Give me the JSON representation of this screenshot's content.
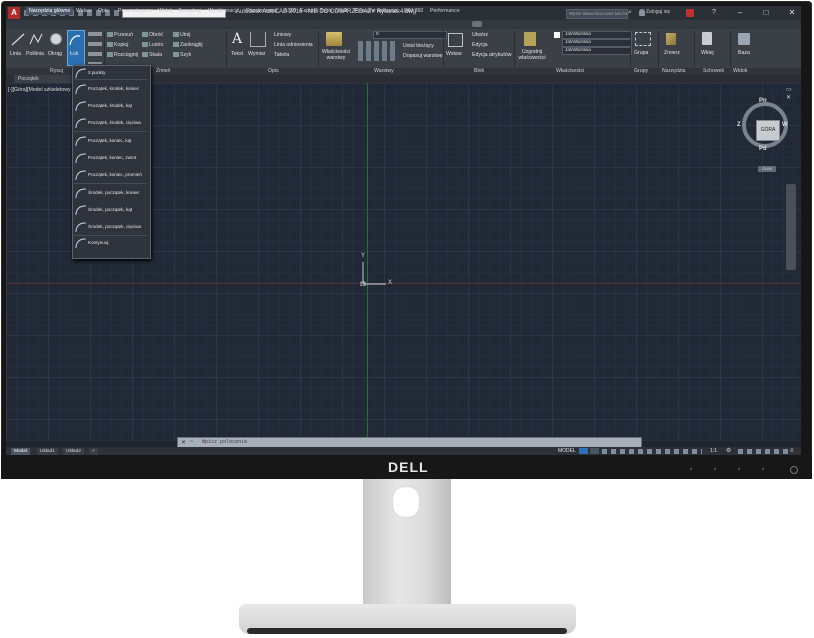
{
  "device": {
    "brand": "DELL"
  },
  "app": {
    "title": "Autodesk AutoCAD 2016 - NIE DO ODSPRZEDAŻY   Rysunek4.dwg",
    "search_placeholder": "Wpisz słowo kluczowe lub frazę",
    "signin_label": "Zaloguj się"
  },
  "ribbon_tabs": [
    "Narzędzia główne",
    "Wstaw",
    "Opis",
    "Parametryczne",
    "Widok",
    "Zarządzaj",
    "Wyniki pracy",
    "Rozszerzenia",
    "A360",
    "Express Tools",
    "Vault",
    "Polecane aplikacje",
    "BIM 360",
    "Performance"
  ],
  "ribbon": {
    "draw": {
      "line": "Linia",
      "polyline": "Polilinia",
      "circle": "Okrąg",
      "arc": "Łuk"
    },
    "modify": {
      "move": "Przesuń",
      "rotate": "Obróć",
      "trim": "Utnij",
      "copy": "Kopiuj",
      "mirror": "Lustro",
      "fillet": "Zaokrąglij",
      "stretch": "Rozciągnij",
      "scale": "Skala",
      "array": "Szyk"
    },
    "annotation": {
      "text": "Tekst",
      "dimension": "Wymiar",
      "linear": "Liniowy",
      "leader": "Linia odniesienia",
      "table": "Tabela"
    },
    "layers": {
      "layer_properties": "Właściwości warstwy",
      "current_layer": "0",
      "make_current": "Ustal bieżący",
      "match_layer": "Dopasuj warstwę"
    },
    "block": {
      "insert": "Wstaw",
      "create": "Utwórz",
      "edit": "Edycja",
      "edit_attributes": "Edycja atrybutów"
    },
    "properties": {
      "match": "Uzgodnij właściwości",
      "color": "JakWarstwa",
      "linetype": "JakWarstwa",
      "lineweight": "JakWarstwa"
    },
    "groups": {
      "group": "Grupa"
    },
    "utilities": {
      "measure": "Zmierz"
    },
    "clipboard": {
      "paste": "Wklej"
    },
    "view": {
      "base": "Baza"
    }
  },
  "panel_labels": [
    "Rysuj",
    "Zmień",
    "Opis",
    "Warstwy",
    "Blok",
    "Właściwości",
    "Grupy",
    "Narzędzia",
    "Schowek",
    "Widok"
  ],
  "document_tab": "Początek",
  "viewport_controls": "[-][Góra][Model szkieletowy 2D]",
  "arc_menu": {
    "items": [
      "3 punkty",
      "Początek, środek, koniec",
      "Początek, środek, kąt",
      "Początek, środek, cięciwa",
      "Początek, koniec, kąt",
      "Początek, koniec, zwrot",
      "Początek, koniec, promień",
      "Środek, początek, koniec",
      "Środek, początek, kąt",
      "Środek, początek, cięciwa",
      "Kontynuuj"
    ]
  },
  "viewcube": {
    "face": "GÓRA",
    "north": "Pn",
    "south": "Pd",
    "east": "W",
    "west": "Z",
    "wcs": "GUW"
  },
  "ucs": {
    "x_label": "X",
    "y_label": "Y"
  },
  "command_line": {
    "placeholder": "Wpisz polecenie"
  },
  "layout_tabs": [
    "Model",
    "Układ1",
    "Układ2"
  ],
  "status": {
    "model_label": "MODEL",
    "scale": "1:1"
  }
}
